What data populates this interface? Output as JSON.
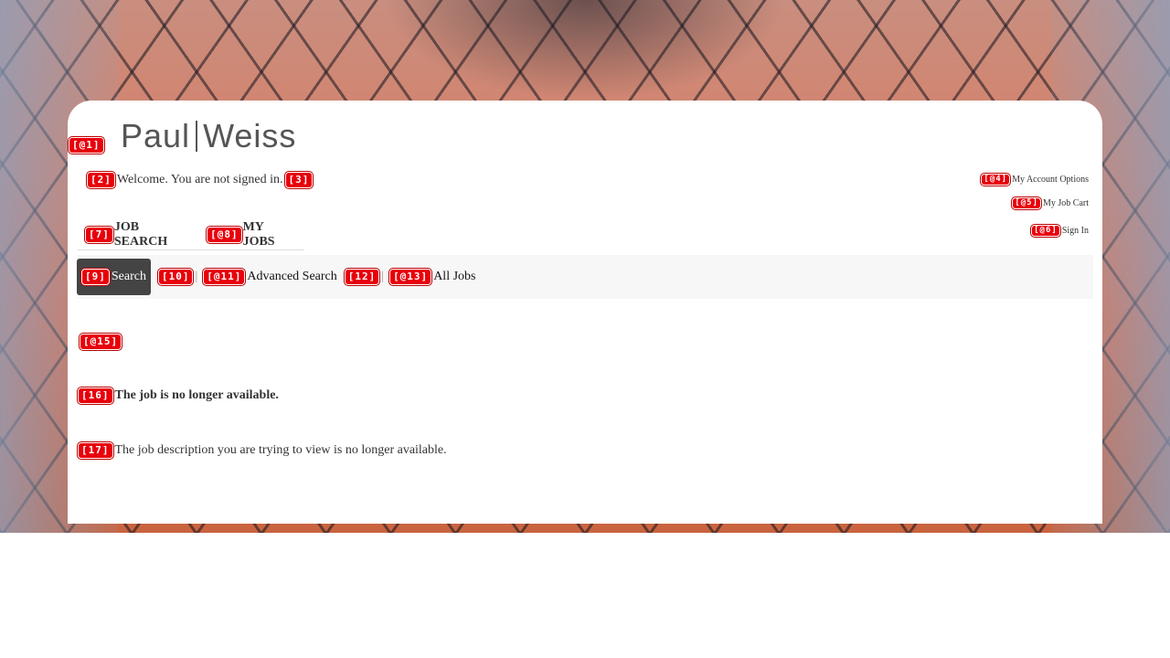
{
  "header": {
    "logo_left": "Paul",
    "logo_right": "Weiss"
  },
  "markers": {
    "m1": "[@1]",
    "m2": "[2]",
    "m3": "[3]",
    "m4": "[@4]",
    "m5": "[@5]",
    "m6": "[@6]",
    "m7": "[7]",
    "m8": "[@8]",
    "m9": "[9]",
    "m10": "[10]",
    "m11": "[@11]",
    "m12": "[12]",
    "m13": "[@13]",
    "m15": "[@15]",
    "m16": "[16]",
    "m17": "[17]"
  },
  "account": {
    "welcome": "Welcome. You are not signed in.",
    "my_account_options": "My Account Options",
    "my_job_cart": "My Job Cart",
    "sign_in": "Sign In"
  },
  "tabs": [
    {
      "label": "JOB SEARCH"
    },
    {
      "label": "MY JOBS"
    }
  ],
  "subnav": {
    "search": "Search",
    "advanced_search": "Advanced Search",
    "all_jobs": "All Jobs",
    "separator": "|"
  },
  "message": {
    "title": "The job is no longer available.",
    "description": "The job description you are trying to view is no longer available."
  }
}
